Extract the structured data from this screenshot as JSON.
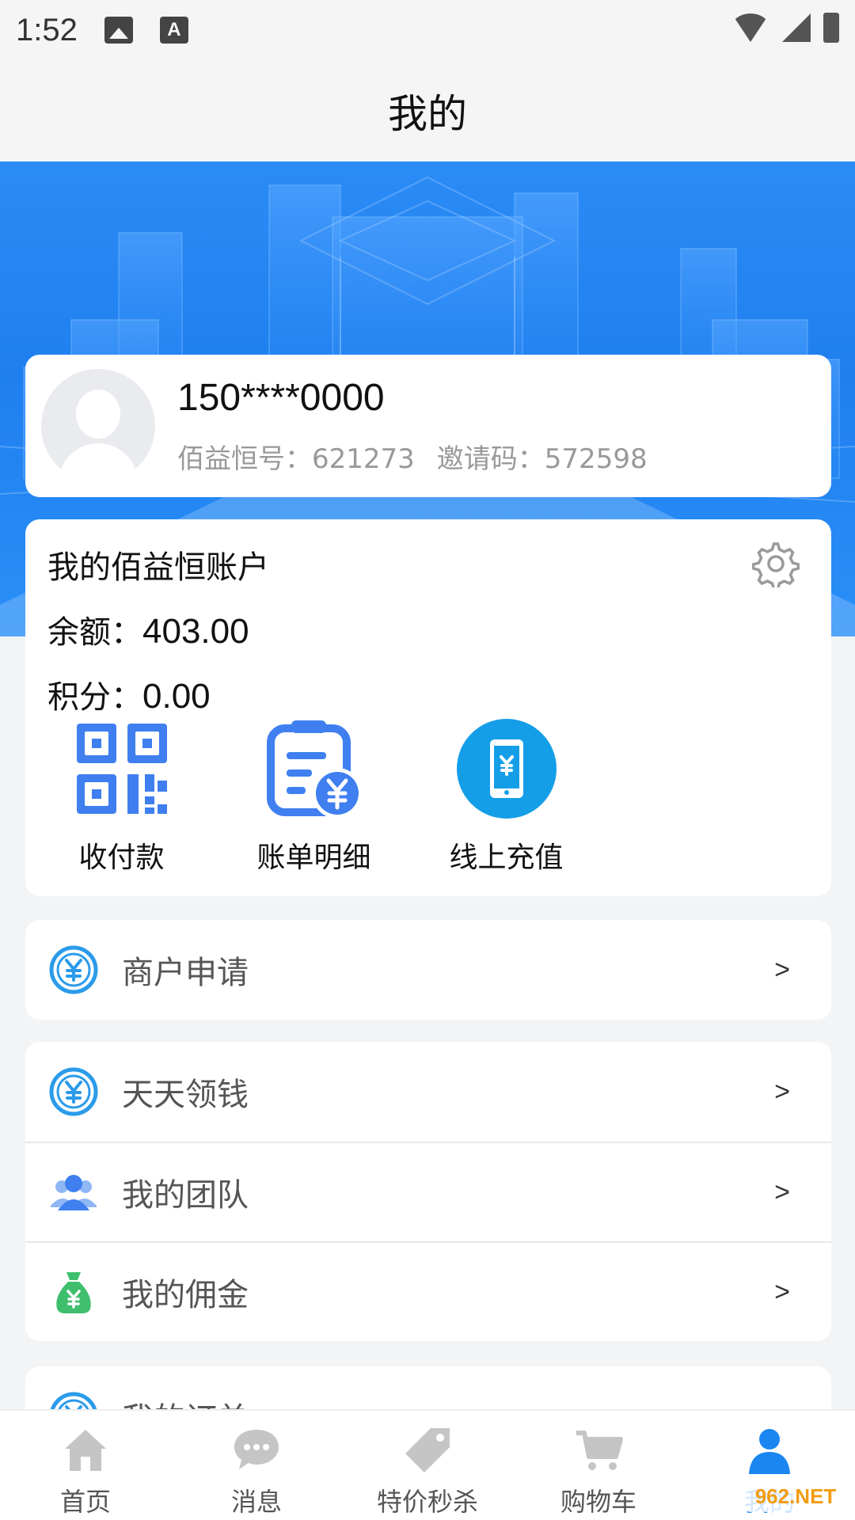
{
  "status_bar": {
    "time": "1:52"
  },
  "header": {
    "title": "我的"
  },
  "profile": {
    "phone": "150****0000",
    "id_label": "佰益恒号：621273",
    "invite_label": "邀请码：572598"
  },
  "account": {
    "title": "我的佰益恒账户",
    "balance_label": "余额：",
    "balance_value": "403.00",
    "points_label": "积分：",
    "points_value": "0.00",
    "actions": [
      {
        "label": "收付款",
        "icon": "qr-code-icon"
      },
      {
        "label": "账单明细",
        "icon": "bill-detail-icon"
      },
      {
        "label": "线上充值",
        "icon": "phone-recharge-icon"
      }
    ]
  },
  "menu": {
    "merchant": {
      "label": "商户申请",
      "arrow": ">"
    },
    "daily_money": {
      "label": "天天领钱",
      "arrow": ">"
    },
    "my_team": {
      "label": "我的团队",
      "arrow": ">"
    },
    "my_commission": {
      "label": "我的佣金",
      "arrow": ">"
    },
    "my_orders": {
      "label": "我的订单",
      "arrow": ">"
    }
  },
  "tabbar": {
    "items": [
      {
        "label": "首页",
        "icon": "home-icon"
      },
      {
        "label": "消息",
        "icon": "message-icon"
      },
      {
        "label": "特价秒杀",
        "icon": "tag-icon"
      },
      {
        "label": "购物车",
        "icon": "cart-icon"
      },
      {
        "label": "我的",
        "icon": "user-icon"
      }
    ],
    "active_index": 4
  },
  "colors": {
    "primary": "#1b86f2",
    "hero": "#2288f4",
    "page_bg": "#f3f4f6"
  }
}
